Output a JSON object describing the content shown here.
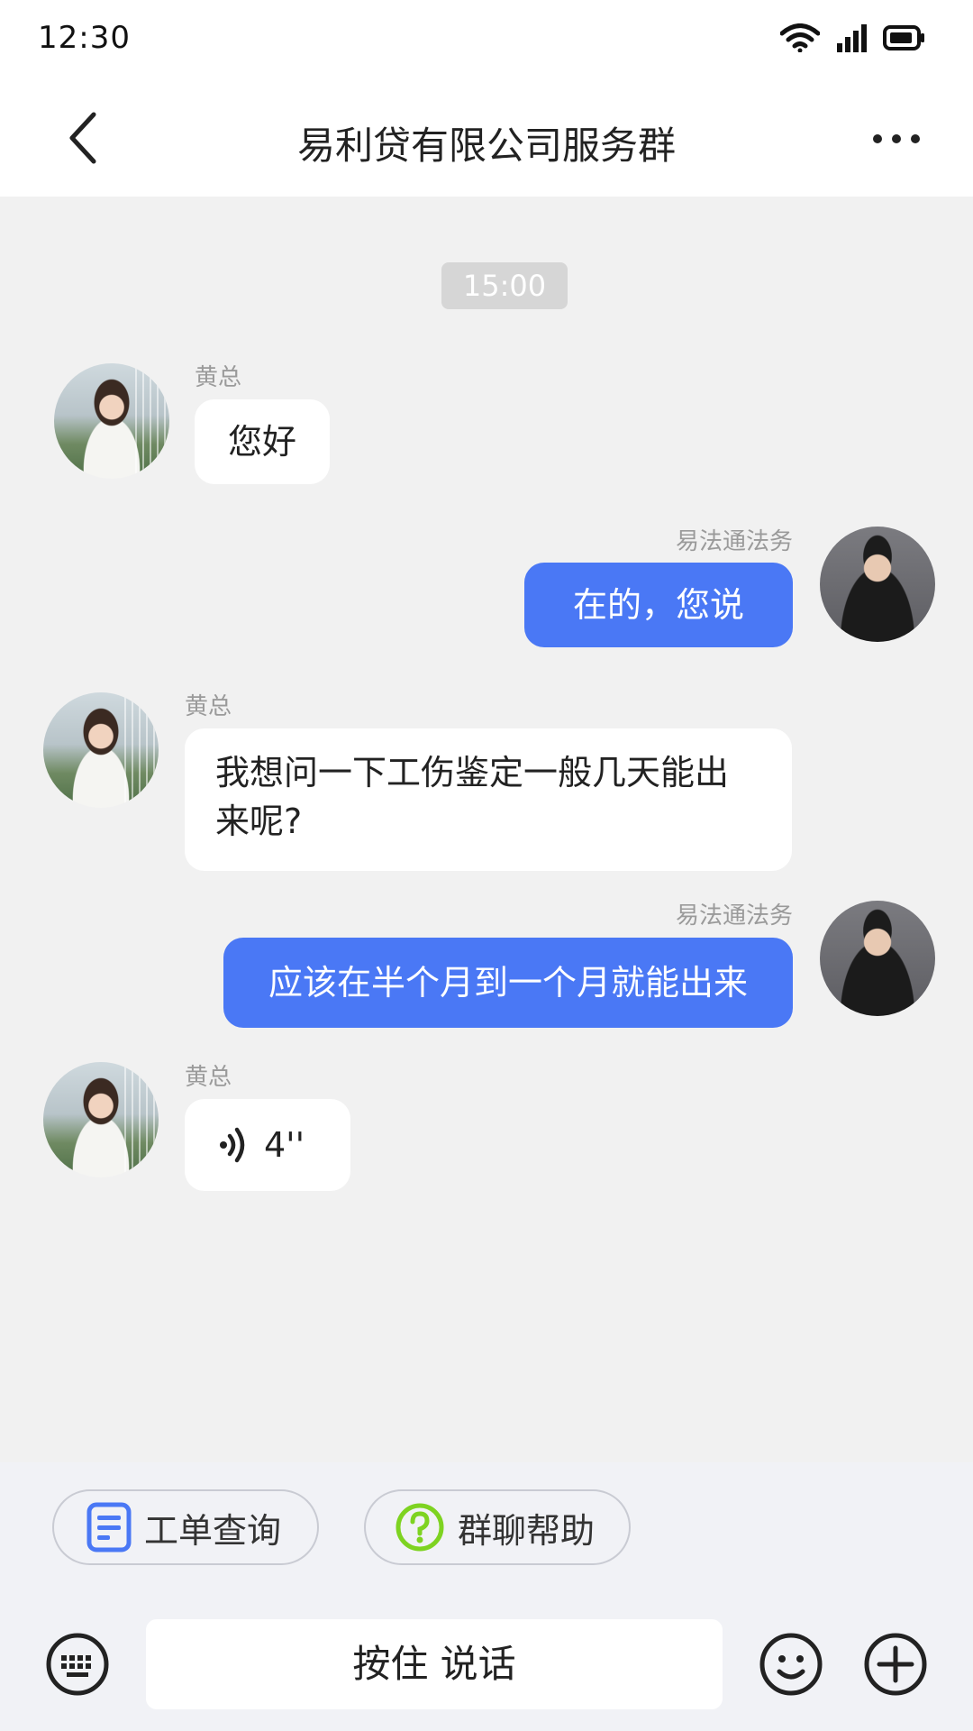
{
  "status_bar": {
    "time": "12:30"
  },
  "header": {
    "title": "易利贷有限公司服务群"
  },
  "chat": {
    "timestamp": "15:00",
    "messages": [
      {
        "sender": "黄总",
        "text": "您好"
      },
      {
        "sender": "易法通法务",
        "text": "在的，您说"
      },
      {
        "sender": "黄总",
        "text": "我想问一下工伤鉴定一般几天能出来呢?"
      },
      {
        "sender": "易法通法务",
        "text": "应该在半个月到一个月就能出来"
      },
      {
        "sender": "黄总",
        "voice_duration": "4''"
      }
    ]
  },
  "quick_actions": [
    {
      "label": "工单查询",
      "icon": "document-icon"
    },
    {
      "label": "群聊帮助",
      "icon": "help-circle-icon"
    }
  ],
  "input_bar": {
    "talk_label": "按住 说话"
  },
  "colors": {
    "outgoing_bubble": "#4a78f5",
    "incoming_bubble": "#ffffff",
    "background": "#f1f1f1",
    "help_icon": "#7ed321"
  }
}
